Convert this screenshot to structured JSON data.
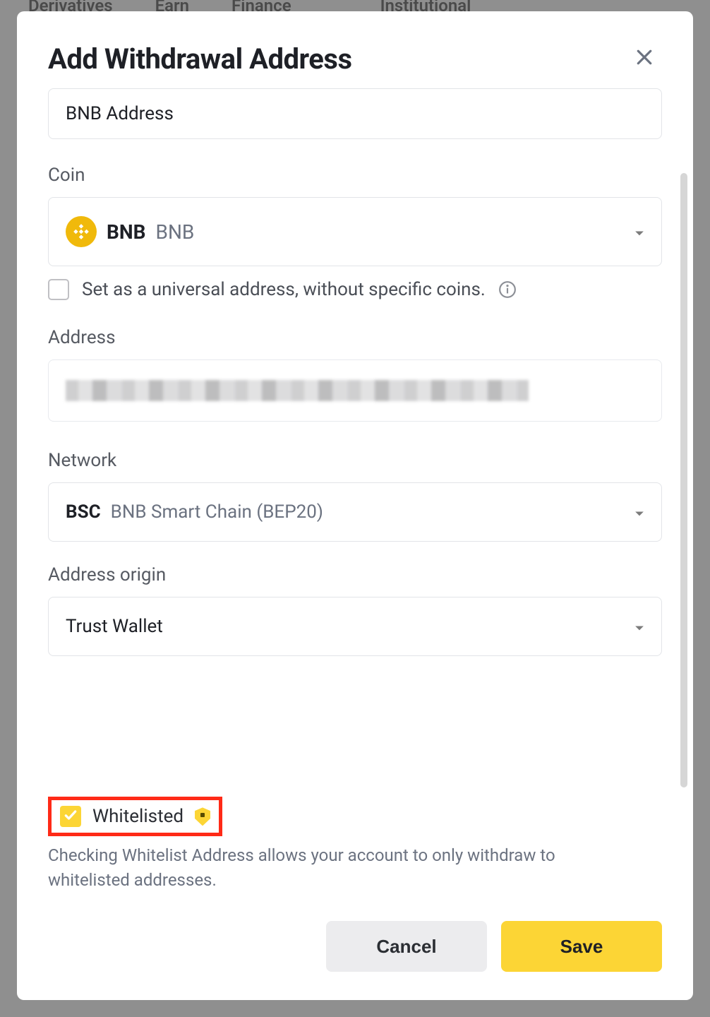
{
  "dialog": {
    "title": "Add Withdrawal Address",
    "fields": {
      "label_value": "BNB Address",
      "coin_label": "Coin",
      "coin_symbol": "BNB",
      "coin_name": "BNB",
      "universal_checkbox_label": "Set as a universal address, without specific coins.",
      "address_label": "Address",
      "network_label": "Network",
      "network_symbol": "BSC",
      "network_name": "BNB Smart Chain (BEP20)",
      "origin_label": "Address origin",
      "origin_value": "Trust Wallet"
    },
    "whitelist": {
      "label": "Whitelisted",
      "help": "Checking Whitelist Address allows your account to only withdraw to whitelisted addresses."
    },
    "footer": {
      "cancel": "Cancel",
      "save": "Save"
    }
  }
}
